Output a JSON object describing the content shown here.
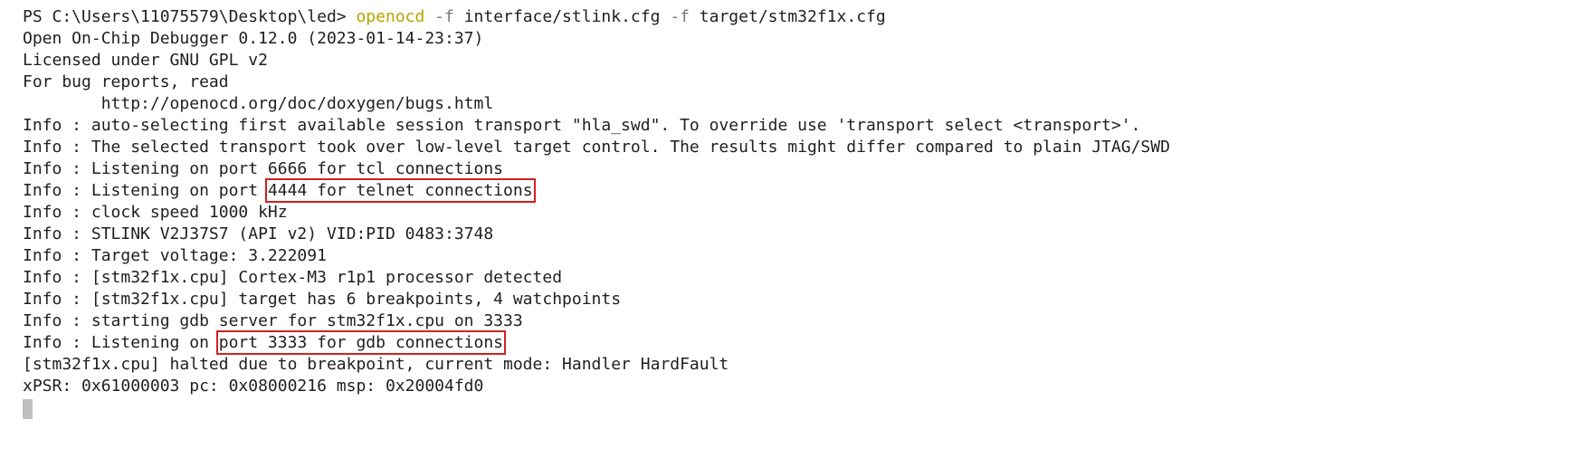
{
  "terminal": {
    "prompt": {
      "path": "PS C:\\Users\\11075579\\Desktop\\led> ",
      "command": "openocd",
      "flag1": " -f ",
      "arg1": "interface/stlink.cfg",
      "flag2": " -f ",
      "arg2": "target/stm32f1x.cfg"
    },
    "lines": [
      "Open On-Chip Debugger 0.12.0 (2023-01-14-23:37)",
      "Licensed under GNU GPL v2",
      "For bug reports, read",
      "        http://openocd.org/doc/doxygen/bugs.html",
      "Info : auto-selecting first available session transport \"hla_swd\". To override use 'transport select <transport>'.",
      "Info : The selected transport took over low-level target control. The results might differ compared to plain JTAG/SWD",
      "Info : Listening on port 6666 for tcl connections"
    ],
    "telnet_line": {
      "prefix": "Info : Listening on port ",
      "highlight": "4444 for telnet connections"
    },
    "lines2": [
      "Info : clock speed 1000 kHz",
      "Info : STLINK V2J37S7 (API v2) VID:PID 0483:3748",
      "Info : Target voltage: 3.222091",
      "Info : [stm32f1x.cpu] Cortex-M3 r1p1 processor detected",
      "Info : [stm32f1x.cpu] target has 6 breakpoints, 4 watchpoints",
      "Info : starting gdb server for stm32f1x.cpu on 3333"
    ],
    "gdb_line": {
      "prefix": "Info : Listening on ",
      "highlight": "port 3333 for gdb connections"
    },
    "lines3": [
      "[stm32f1x.cpu] halted due to breakpoint, current mode: Handler HardFault",
      "xPSR: 0x61000003 pc: 0x08000216 msp: 0x20004fd0"
    ],
    "colors": {
      "command": "#b8a300",
      "flag": "#7a7a7a",
      "highlight_box": "#d32020",
      "cursor": "#bfbfbf"
    }
  }
}
